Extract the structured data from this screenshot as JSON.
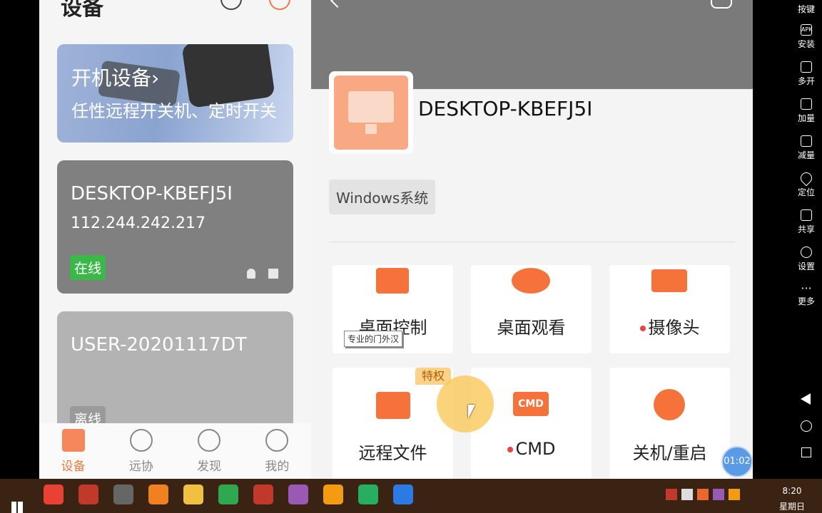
{
  "left_panel": {
    "title": "设备",
    "promo": {
      "title": "开机设备",
      "chevron": "›",
      "subtitle": "任性远程开关机、定时开关"
    },
    "devices": [
      {
        "name": "DESKTOP-KBEFJ5I",
        "ip": "112.244.242.217",
        "status": "在线",
        "status_color": "#3cb84a"
      },
      {
        "name": "USER-20201117DT",
        "ip": "",
        "status": "离线",
        "status_color": "#9a9a9a"
      }
    ],
    "nav": [
      {
        "label": "设备",
        "icon": "device-icon",
        "active": true
      },
      {
        "label": "远协",
        "icon": "remote-assist-icon",
        "active": false
      },
      {
        "label": "发现",
        "icon": "compass-icon",
        "active": false
      },
      {
        "label": "我的",
        "icon": "profile-icon",
        "active": false
      }
    ]
  },
  "right_panel": {
    "device_title": "DESKTOP-KBEFJ5I",
    "os_tag": "Windows系统",
    "tiles": [
      {
        "label": "桌面控制",
        "icon": "desktop-control-icon",
        "dot": false
      },
      {
        "label": "桌面观看",
        "icon": "eye-icon",
        "dot": false
      },
      {
        "label": "摄像头",
        "icon": "camera-icon",
        "dot": true
      },
      {
        "label": "远程文件",
        "icon": "folder-icon",
        "dot": false
      },
      {
        "label": "CMD",
        "icon": "cmd-icon",
        "dot": true,
        "icon_text": "CMD"
      },
      {
        "label": "关机/重启",
        "icon": "power-icon",
        "dot": false
      }
    ],
    "vip_badge": "特权",
    "tooltip": "专业的门外汉",
    "timer": "01:02"
  },
  "side_toolbar": [
    {
      "label": "按键",
      "icon": "keys-icon"
    },
    {
      "label": "安装",
      "icon": "apk-icon",
      "icon_text": "APK"
    },
    {
      "label": "多开",
      "icon": "multi-open-icon"
    },
    {
      "label": "加量",
      "icon": "volume-up-icon"
    },
    {
      "label": "减量",
      "icon": "volume-down-icon"
    },
    {
      "label": "定位",
      "icon": "location-icon"
    },
    {
      "label": "共享",
      "icon": "folder-share-icon"
    },
    {
      "label": "设置",
      "icon": "gear-icon"
    },
    {
      "label": "更多",
      "icon": "more-icon",
      "icon_text": "···"
    }
  ],
  "taskbar": {
    "time": "8:20",
    "day": "星期日",
    "apps": [
      "chrome-icon",
      "media-icon",
      "obs-icon",
      "search-icon",
      "file-explorer-icon",
      "arrows-icon",
      "filezilla-icon",
      "app-icon-1",
      "app-icon-2",
      "globe-icon",
      "app-icon-3"
    ],
    "app_colors": [
      "#e94235",
      "#c0392b",
      "#666666",
      "#f08020",
      "#f0c040",
      "#2fa84f",
      "#c0392b",
      "#9b59b6",
      "#f39c12",
      "#27ae60",
      "#2c7be5"
    ]
  },
  "colors": {
    "accent": "#f5733a",
    "header_gray": "#7a7a7a"
  }
}
